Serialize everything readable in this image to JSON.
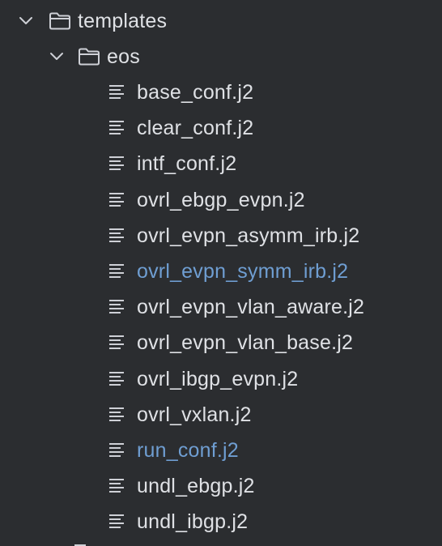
{
  "project_tree": {
    "root_folder": {
      "name": "templates",
      "expanded": true,
      "icon": "folder-icon"
    },
    "subfolder": {
      "name": "eos",
      "expanded": true,
      "icon": "folder-icon"
    },
    "files": [
      {
        "name": "base_conf.j2",
        "icon": "text-file-icon",
        "modified": false
      },
      {
        "name": "clear_conf.j2",
        "icon": "text-file-icon",
        "modified": false
      },
      {
        "name": "intf_conf.j2",
        "icon": "text-file-icon",
        "modified": false
      },
      {
        "name": "ovrl_ebgp_evpn.j2",
        "icon": "text-file-icon",
        "modified": false
      },
      {
        "name": "ovrl_evpn_asymm_irb.j2",
        "icon": "text-file-icon",
        "modified": false
      },
      {
        "name": "ovrl_evpn_symm_irb.j2",
        "icon": "text-file-icon",
        "modified": true
      },
      {
        "name": "ovrl_evpn_vlan_aware.j2",
        "icon": "text-file-icon",
        "modified": false
      },
      {
        "name": "ovrl_evpn_vlan_base.j2",
        "icon": "text-file-icon",
        "modified": false
      },
      {
        "name": "ovrl_ibgp_evpn.j2",
        "icon": "text-file-icon",
        "modified": false
      },
      {
        "name": "ovrl_vxlan.j2",
        "icon": "text-file-icon",
        "modified": false
      },
      {
        "name": "run_conf.j2",
        "icon": "text-file-icon",
        "modified": true
      },
      {
        "name": "undl_ebgp.j2",
        "icon": "text-file-icon",
        "modified": false
      },
      {
        "name": "undl_ibgp.j2",
        "icon": "text-file-icon",
        "modified": false
      }
    ]
  },
  "colors": {
    "background": "#2b2d30",
    "text": "#dfe1e5",
    "modified_text": "#6f9ed2",
    "icon": "#ced0d6"
  }
}
